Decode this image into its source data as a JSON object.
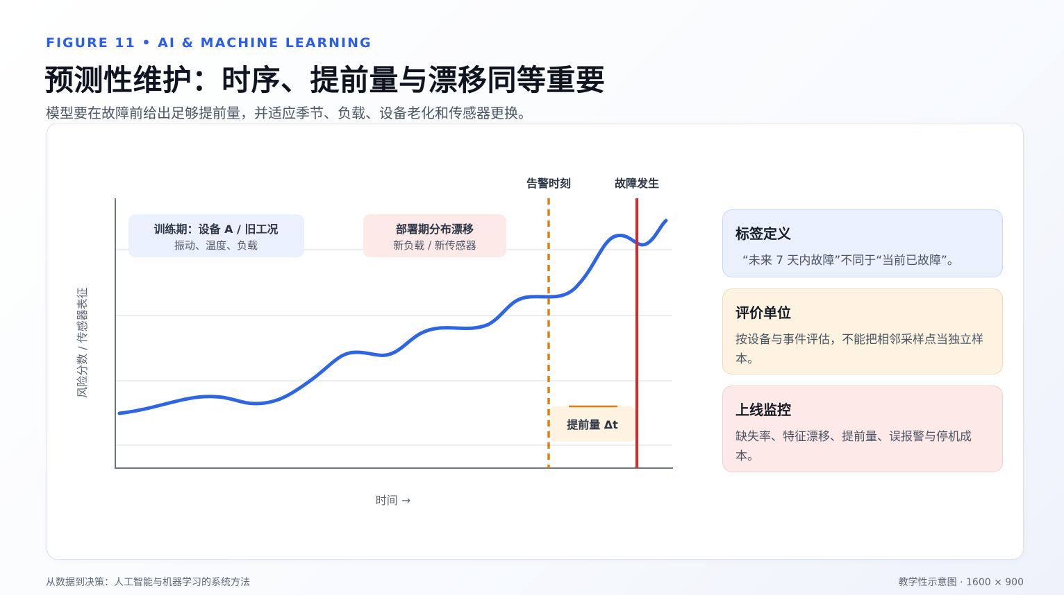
{
  "header": {
    "kicker": "FIGURE 11 • AI & MACHINE LEARNING",
    "title": "预测性维护：时序、提前量与漂移同等重要",
    "subtitle": "模型要在故障前给出足够提前量，并适应季节、负载、设备老化和传感器更换。"
  },
  "diagram": {
    "y_axis_label": "风险分数 / 传感器表征",
    "x_axis_label": "时间 →",
    "alert_label": "告警时刻",
    "failure_label": "故障发生",
    "training_title": "训练期：设备 A / 旧工况",
    "training_sub": "振动、温度、负载",
    "drift_title": "部署期分布漂移",
    "drift_sub": "新负载 / 新传感器",
    "lead_label": "提前量 Δt",
    "colors": {
      "curve": "#2d65e3",
      "alert_line": "#e07d10",
      "failure_line": "#d62a2a",
      "axis": "#6b7585",
      "grid": "#e3e7ee"
    }
  },
  "side_boxes": [
    {
      "title": "标签定义",
      "text": "“未来 7 天内故障”不同于“当前已故障”。"
    },
    {
      "title": "评价单位",
      "text": "按设备与事件评估，不能把相邻采样点当独立样本。"
    },
    {
      "title": "上线监控",
      "text": "缺失率、特征漂移、提前量、误报警与停机成本。"
    }
  ],
  "footer": {
    "left": "从数据到决策：人工智能与机器学习的系统方法",
    "right": "教学性示意图 · 1600 × 900"
  }
}
